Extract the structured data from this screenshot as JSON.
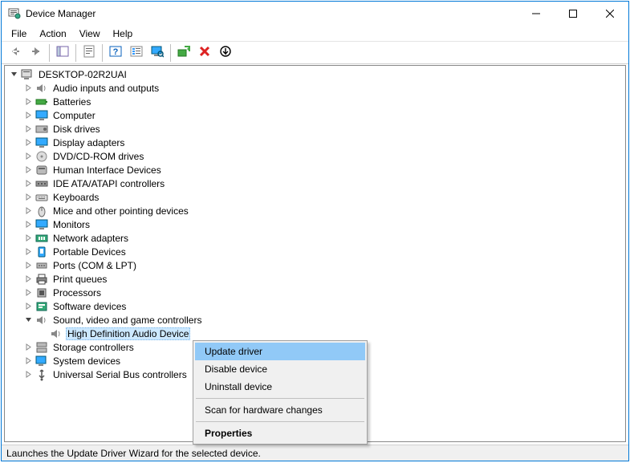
{
  "window": {
    "title": "Device Manager"
  },
  "menu": {
    "file": "File",
    "action": "Action",
    "view": "View",
    "help": "Help"
  },
  "root": {
    "label": "DESKTOP-02R2UAI"
  },
  "categories": [
    {
      "label": "Audio inputs and outputs",
      "icon": "speaker"
    },
    {
      "label": "Batteries",
      "icon": "battery"
    },
    {
      "label": "Computer",
      "icon": "monitor"
    },
    {
      "label": "Disk drives",
      "icon": "disk"
    },
    {
      "label": "Display adapters",
      "icon": "monitor"
    },
    {
      "label": "DVD/CD-ROM drives",
      "icon": "disc"
    },
    {
      "label": "Human Interface Devices",
      "icon": "hid"
    },
    {
      "label": "IDE ATA/ATAPI controllers",
      "icon": "ide"
    },
    {
      "label": "Keyboards",
      "icon": "keyboard"
    },
    {
      "label": "Mice and other pointing devices",
      "icon": "mouse"
    },
    {
      "label": "Monitors",
      "icon": "monitor"
    },
    {
      "label": "Network adapters",
      "icon": "network"
    },
    {
      "label": "Portable Devices",
      "icon": "portable"
    },
    {
      "label": "Ports (COM & LPT)",
      "icon": "port"
    },
    {
      "label": "Print queues",
      "icon": "printer"
    },
    {
      "label": "Processors",
      "icon": "cpu"
    },
    {
      "label": "Software devices",
      "icon": "software"
    },
    {
      "label": "Sound, video and game controllers",
      "icon": "speaker",
      "expanded": true,
      "children": [
        {
          "label": "High Definition Audio Device",
          "icon": "speaker",
          "selected": true
        }
      ]
    },
    {
      "label": "Storage controllers",
      "icon": "storage"
    },
    {
      "label": "System devices",
      "icon": "system"
    },
    {
      "label": "Universal Serial Bus controllers",
      "icon": "usb"
    }
  ],
  "context_menu": {
    "update": "Update driver",
    "disable": "Disable device",
    "uninstall": "Uninstall device",
    "scan": "Scan for hardware changes",
    "properties": "Properties"
  },
  "status": "Launches the Update Driver Wizard for the selected device."
}
